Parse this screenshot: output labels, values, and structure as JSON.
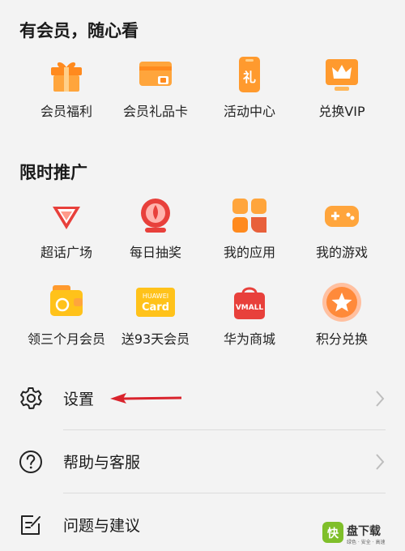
{
  "member_section": {
    "title": "有会员，随心看",
    "items": [
      {
        "label": "会员福利",
        "icon": "gift-icon"
      },
      {
        "label": "会员礼品卡",
        "icon": "gift-card-icon"
      },
      {
        "label": "活动中心",
        "icon": "activity-phone-icon"
      },
      {
        "label": "兑换VIP",
        "icon": "crown-screen-icon"
      }
    ]
  },
  "promo_section": {
    "title": "限时推广",
    "items": [
      {
        "label": "超话广场",
        "icon": "diamond-badge-icon"
      },
      {
        "label": "每日抽奖",
        "icon": "lottery-icon"
      },
      {
        "label": "我的应用",
        "icon": "apps-grid-icon"
      },
      {
        "label": "我的游戏",
        "icon": "gamepad-icon"
      },
      {
        "label": "领三个月会员",
        "icon": "wallet-icon"
      },
      {
        "label": "送93天会员",
        "icon": "huawei-card-icon"
      },
      {
        "label": "华为商城",
        "icon": "vmall-bag-icon"
      },
      {
        "label": "积分兑换",
        "icon": "star-coin-icon"
      }
    ],
    "card_text": {
      "line1": "HUAWEI",
      "line2": "Card"
    },
    "vmall_text": "VMALL"
  },
  "menu": [
    {
      "label": "设置",
      "icon": "gear-icon"
    },
    {
      "label": "帮助与客服",
      "icon": "help-icon"
    },
    {
      "label": "问题与建议",
      "icon": "feedback-icon"
    }
  ],
  "watermark": {
    "text": "盘下载",
    "sub": "绿色 · 安全 · 高速"
  },
  "colors": {
    "orange": "#ff9a2e",
    "red": "#e8403b",
    "yellow": "#ffc21a",
    "background": "#f3f3f3",
    "annotation_arrow": "#d9232c"
  }
}
